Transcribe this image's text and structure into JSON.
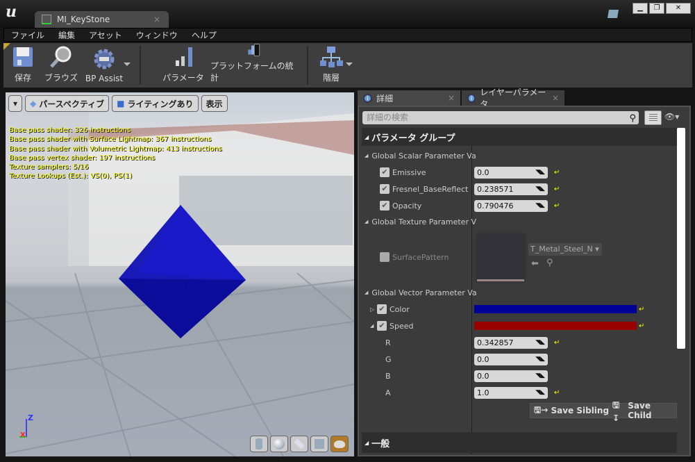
{
  "window": {
    "doc_tab": "MI_KeyStone",
    "close": "×",
    "controls": [
      "▁",
      "❐",
      "✕"
    ]
  },
  "menu": [
    "ファイル",
    "編集",
    "アセット",
    "ウィンドウ",
    "ヘルプ"
  ],
  "toolbar": {
    "save": "保存",
    "browse": "ブラウズ",
    "bp_assist": "BP Assist",
    "params": "パラメータ",
    "platform_stats": "プラットフォームの統計",
    "hierarchy": "階層"
  },
  "viewport": {
    "buttons": {
      "perspective": "パースペクティブ",
      "lighting": "ライティングあり",
      "show": "表示"
    },
    "stats": [
      "Base pass shader: 326 instructions",
      "Base pass shader with Surface Lightmap: 367 instructions",
      "Base pass shader with Volumetric Lightmap: 413 instructions",
      "Base pass vertex shader: 197 instructions",
      "Texture samplers: 5/16",
      "Texture Lookups (Est.): VS(0), PS(1)"
    ],
    "axis": {
      "z": "Z",
      "x": "X"
    },
    "mesh_color": "#0a0ab4"
  },
  "tabs": {
    "details": "詳細",
    "layer_params": "レイヤーパラメータ",
    "close": "×"
  },
  "details": {
    "search_placeholder": "詳細の検索",
    "param_group": "パラメータ グループ",
    "scalar_header": "Global Scalar Parameter Val",
    "scalars": [
      {
        "name": "Emissive",
        "value": "0.0"
      },
      {
        "name": "Fresnel_BaseReflectFra",
        "value": "0.238571"
      },
      {
        "name": "Opacity",
        "value": "0.790476"
      }
    ],
    "texture_header": "Global Texture Parameter V",
    "texture": {
      "name": "SurfacePattern",
      "asset": "T_Metal_Steel_N"
    },
    "vector_header": "Global Vector Parameter Va",
    "vectors": [
      {
        "name": "Color",
        "color": "#000099"
      },
      {
        "name": "Speed",
        "color": "#990000"
      }
    ],
    "speed_components": [
      {
        "name": "R",
        "value": "0.342857"
      },
      {
        "name": "G",
        "value": "0.0"
      },
      {
        "name": "B",
        "value": "0.0"
      },
      {
        "name": "A",
        "value": "1.0"
      }
    ],
    "save_sibling": "Save Sibling",
    "save_child": "Save Child",
    "general": "一般"
  }
}
